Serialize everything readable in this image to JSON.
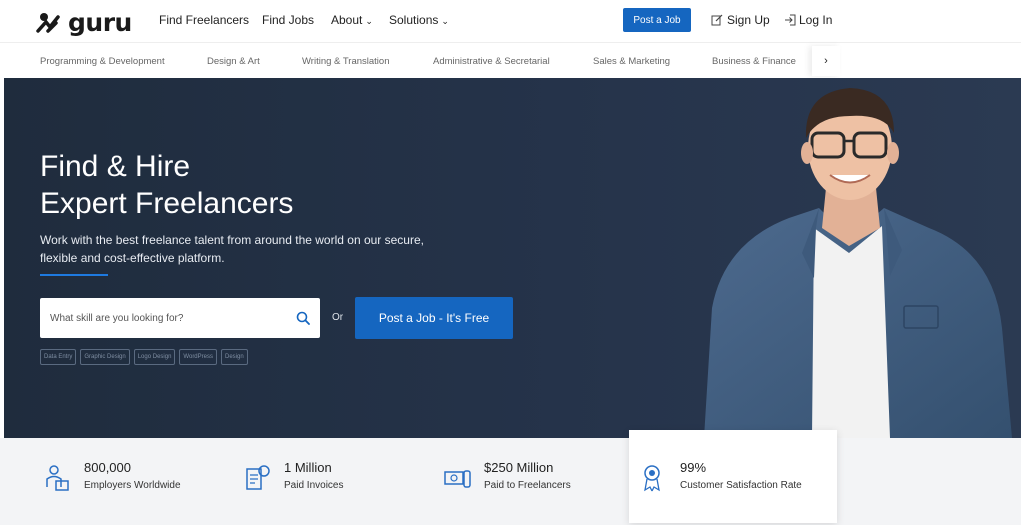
{
  "brand": {
    "name": "guru"
  },
  "topnav": {
    "links": [
      {
        "label": "Find Freelancers"
      },
      {
        "label": "Find Jobs"
      },
      {
        "label": "About"
      },
      {
        "label": "Solutions"
      }
    ],
    "post_job": "Post a Job",
    "sign_up": "Sign Up",
    "log_in": "Log In"
  },
  "categories": [
    "Programming & Development",
    "Design & Art",
    "Writing & Translation",
    "Administrative & Secretarial",
    "Sales & Marketing",
    "Business & Finance"
  ],
  "hero": {
    "title_line1": "Find & Hire",
    "title_line2": "Expert Freelancers",
    "subtitle": "Work with the best freelance talent from around the world on our secure, flexible and cost-effective platform.",
    "search_placeholder": "What skill are you looking for?",
    "or_label": "Or",
    "post_button": "Post a Job - It's Free",
    "chips": [
      "Data Entry",
      "Graphic Design",
      "Logo Design",
      "WordPress",
      "Design"
    ]
  },
  "stats": [
    {
      "value": "800,000",
      "label": "Employers Worldwide",
      "icon": "employer-icon"
    },
    {
      "value": "1 Million",
      "label": "Paid Invoices",
      "icon": "invoice-icon"
    },
    {
      "value": "$250 Million",
      "label": "Paid to Freelancers",
      "icon": "money-icon"
    },
    {
      "value": "99%",
      "label": "Customer Satisfaction Rate",
      "icon": "award-icon"
    }
  ],
  "colors": {
    "accent": "#1566c0",
    "hero_bg": "#25334a",
    "stats_bg": "#f3f4f6"
  }
}
